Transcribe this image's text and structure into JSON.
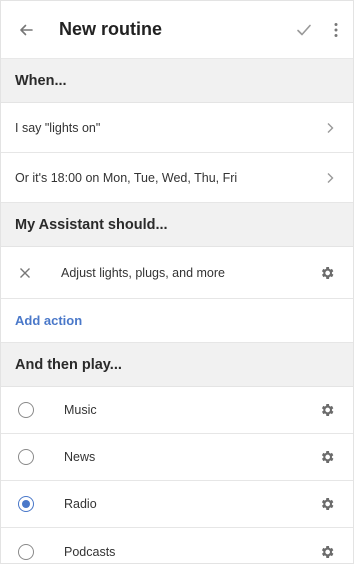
{
  "header": {
    "title": "New routine",
    "back_icon": "arrow-left-icon",
    "check_icon": "check-icon",
    "more_icon": "more-vert-icon"
  },
  "when": {
    "heading": "When...",
    "triggers": [
      {
        "label": "I say \"lights on\""
      },
      {
        "label": "Or it's 18:00 on Mon, Tue, Wed, Thu, Fri"
      }
    ]
  },
  "assistant": {
    "heading": "My Assistant should...",
    "actions": [
      {
        "label": "Adjust lights, plugs, and more"
      }
    ],
    "add_action_label": "Add action"
  },
  "then_play": {
    "heading": "And then play...",
    "options": [
      {
        "label": "Music",
        "selected": false
      },
      {
        "label": "News",
        "selected": false
      },
      {
        "label": "Radio",
        "selected": true
      },
      {
        "label": "Podcasts",
        "selected": false
      }
    ]
  },
  "colors": {
    "accent": "#4a78c9",
    "section_bg": "#f1f1f1"
  }
}
